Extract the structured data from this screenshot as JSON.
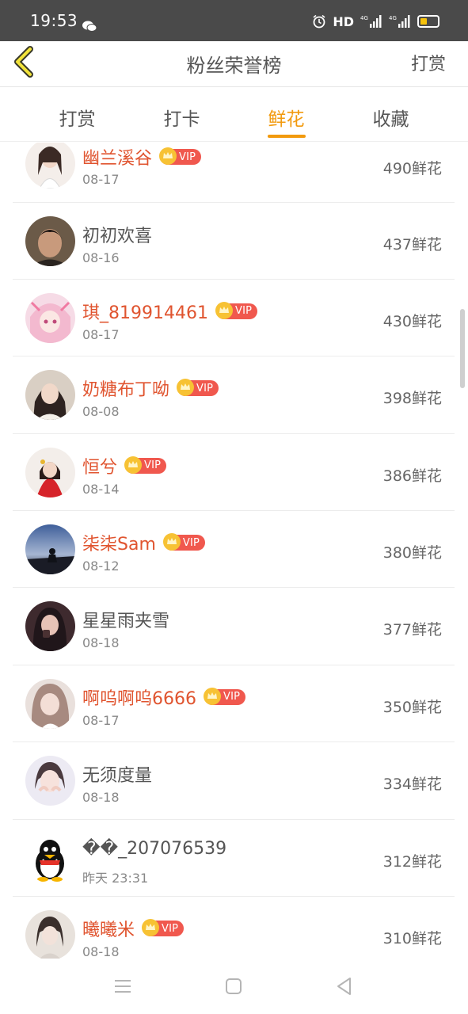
{
  "status_bar": {
    "time": "19:53",
    "hd_label": "HD",
    "network_1": "4G",
    "network_2": "4G"
  },
  "header": {
    "title": "粉丝荣誉榜",
    "action_label": "打赏"
  },
  "tabs": [
    {
      "label": "打赏",
      "active": false
    },
    {
      "label": "打卡",
      "active": false
    },
    {
      "label": "鲜花",
      "active": true
    },
    {
      "label": "收藏",
      "active": false
    }
  ],
  "vip_badge_label": "VIP",
  "rows": [
    {
      "name": "幽兰溪谷",
      "vip": true,
      "date": "08-17",
      "amount": "490鲜花"
    },
    {
      "name": "初初欢喜",
      "vip": false,
      "date": "08-16",
      "amount": "437鲜花"
    },
    {
      "name": "琪_819914461",
      "vip": true,
      "date": "08-17",
      "amount": "430鲜花"
    },
    {
      "name": "奶糖布丁呦",
      "vip": true,
      "date": "08-08",
      "amount": "398鲜花"
    },
    {
      "name": "恒兮",
      "vip": true,
      "date": "08-14",
      "amount": "386鲜花"
    },
    {
      "name": "柒柒Sam",
      "vip": true,
      "date": "08-12",
      "amount": "380鲜花"
    },
    {
      "name": "星星雨夹雪",
      "vip": false,
      "date": "08-18",
      "amount": "377鲜花"
    },
    {
      "name": "啊呜啊呜6666",
      "vip": true,
      "date": "08-17",
      "amount": "350鲜花"
    },
    {
      "name": "无须度量",
      "vip": false,
      "date": "08-18",
      "amount": "334鲜花"
    },
    {
      "name": "��_207076539",
      "vip": false,
      "date": "昨天 23:31",
      "amount": "312鲜花"
    },
    {
      "name": "曦曦米",
      "vip": true,
      "date": "08-18",
      "amount": "310鲜花"
    }
  ],
  "colors": {
    "accent": "#f29a0e",
    "vip_name": "#e0542f",
    "vip_badge": "#f0584e",
    "status_bar": "#4a4a4a"
  }
}
